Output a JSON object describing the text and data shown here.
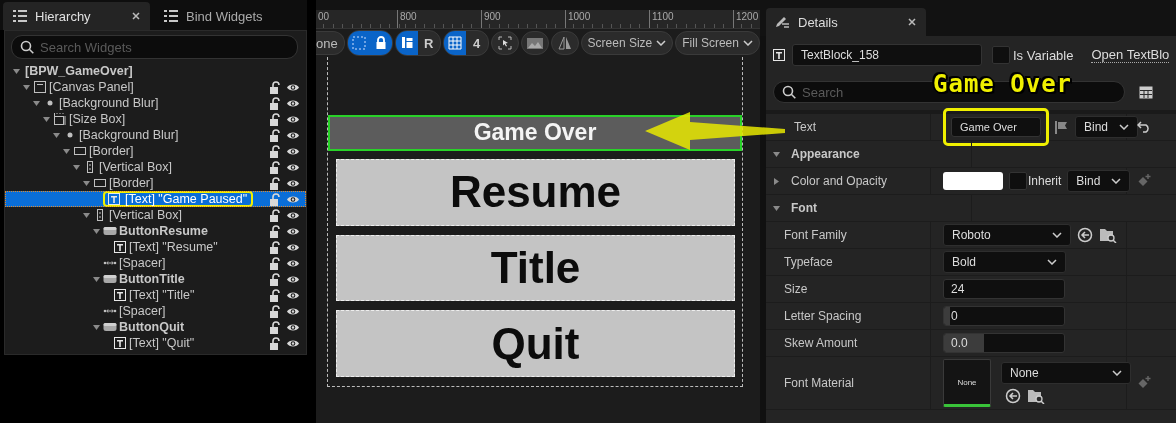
{
  "hierarchy": {
    "tabs": [
      {
        "label": "Hierarchy",
        "selected": true,
        "closable": true
      },
      {
        "label": "Bind Widgets",
        "selected": false,
        "closable": false
      }
    ],
    "search_placeholder": "Search Widgets",
    "tree": [
      {
        "label": "[BPW_GameOver]",
        "kind": "root",
        "selected": false,
        "expanded": true,
        "children": [
          {
            "label": "[Canvas Panel]",
            "kind": "canvas",
            "selected": false,
            "expanded": true,
            "children": [
              {
                "label": "[Background Blur]",
                "kind": "blur",
                "selected": false,
                "expanded": true,
                "children": [
                  {
                    "label": "[Size Box]",
                    "kind": "sizebox",
                    "selected": false,
                    "expanded": true,
                    "children": [
                      {
                        "label": "[Background Blur]",
                        "kind": "blur",
                        "selected": false,
                        "expanded": true,
                        "children": [
                          {
                            "label": "[Border]",
                            "kind": "border",
                            "selected": false,
                            "expanded": true,
                            "children": [
                              {
                                "label": "[Vertical Box]",
                                "kind": "vbox",
                                "selected": false,
                                "expanded": true,
                                "children": [
                                  {
                                    "label": "[Border]",
                                    "kind": "border",
                                    "selected": false,
                                    "expanded": true,
                                    "children": [
                                      {
                                        "label": "[Text] \"Game Paused\"",
                                        "kind": "text",
                                        "selected": true
                                      }
                                    ]
                                  },
                                  {
                                    "label": "[Vertical Box]",
                                    "kind": "vbox",
                                    "selected": false,
                                    "expanded": true,
                                    "children": [
                                      {
                                        "label": "ButtonResume",
                                        "kind": "button",
                                        "selected": false,
                                        "expanded": true,
                                        "children": [
                                          {
                                            "label": "[Text] \"Resume\"",
                                            "kind": "text",
                                            "selected": false
                                          }
                                        ]
                                      },
                                      {
                                        "label": "[Spacer]",
                                        "kind": "spacer",
                                        "selected": false
                                      },
                                      {
                                        "label": "ButtonTitle",
                                        "kind": "button",
                                        "selected": false,
                                        "expanded": true,
                                        "children": [
                                          {
                                            "label": "[Text] \"Title\"",
                                            "kind": "text",
                                            "selected": false
                                          }
                                        ]
                                      },
                                      {
                                        "label": "[Spacer]",
                                        "kind": "spacer",
                                        "selected": false
                                      },
                                      {
                                        "label": "ButtonQuit",
                                        "kind": "button",
                                        "selected": false,
                                        "expanded": true,
                                        "children": [
                                          {
                                            "label": "[Text] \"Quit\"",
                                            "kind": "text",
                                            "selected": false
                                          }
                                        ]
                                      }
                                    ]
                                  }
                                ]
                              }
                            ]
                          }
                        ]
                      }
                    ]
                  }
                ]
              }
            ]
          }
        ]
      }
    ]
  },
  "designer": {
    "ruler": [
      "00",
      "800",
      "900",
      "1000",
      "1100",
      "1200"
    ],
    "toolbar": [
      {
        "kind": "pill",
        "label": "one"
      },
      {
        "kind": "toggles",
        "items": [
          {
            "selected": true
          },
          {
            "selected": true
          }
        ]
      },
      {
        "kind": "toggles",
        "items": [
          {
            "selected": true
          },
          {
            "label": "R",
            "selected": false
          }
        ]
      },
      {
        "kind": "toggles",
        "items": [
          {
            "selected": true
          },
          {
            "label": "4",
            "selected": false
          }
        ]
      },
      {
        "kind": "icon"
      },
      {
        "kind": "icon"
      },
      {
        "kind": "icon"
      },
      {
        "kind": "dropdown",
        "label": "Screen Size"
      },
      {
        "kind": "dropdown",
        "label": "Fill Screen"
      }
    ],
    "heading": "Game Over",
    "buttons": [
      "Resume",
      "Title",
      "Quit"
    ]
  },
  "details": {
    "title": "Details",
    "name": "TextBlock_158",
    "is_variable": false,
    "is_variable_label": "Is Variable",
    "open_link": "Open TextBlo",
    "search_placeholder": "Search",
    "rows": [
      {
        "kind": "text",
        "label": "Text",
        "value": "Game Over",
        "bind": "Bind"
      },
      {
        "kind": "section",
        "label": "Appearance",
        "expanded": true,
        "children": [
          {
            "kind": "color",
            "label": "Color and Opacity",
            "expanded": false,
            "color": "#ffffff",
            "inherit": false,
            "inherit_label": "Inherit",
            "bind": "Bind"
          },
          {
            "kind": "section",
            "label": "Font",
            "expanded": true,
            "children": [
              {
                "kind": "dropdown",
                "label": "Font Family",
                "value": "Roboto",
                "browse": true
              },
              {
                "kind": "dropdown",
                "label": "Typeface",
                "value": "Bold",
                "browse": false
              },
              {
                "kind": "number",
                "label": "Size",
                "value": "24"
              },
              {
                "kind": "number",
                "label": "Letter Spacing",
                "value": "0",
                "level": 0.05
              },
              {
                "kind": "number",
                "label": "Skew Amount",
                "value": "0.0",
                "level": 0.33
              },
              {
                "kind": "material",
                "label": "Font Material",
                "thumb": "None",
                "value": "None"
              }
            ]
          }
        ]
      }
    ]
  },
  "callout": "Game Over"
}
